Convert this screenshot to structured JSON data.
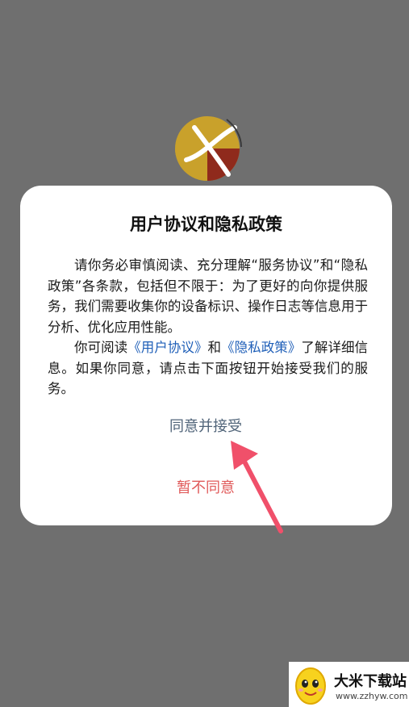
{
  "dialog": {
    "title": "用户协议和隐私政策",
    "paragraph1": "请你务必审慎阅读、充分理解“服务协议”和“隐私政策”各条款，包括但不限于：为了更好的向你提供服务，我们需要收集你的设备标识、操作日志等信息用于分析、优化应用性能。",
    "p2_prefix": "你可阅读",
    "user_agreement_link": "《用户协议》",
    "p2_and": "和",
    "privacy_policy_link": "《隐私政策》",
    "p2_suffix": "了解详细信息。如果你同意，请点击下面按钮开始接受我们的服务。",
    "agree_label": "同意并接受",
    "decline_label": "暂不同意"
  },
  "watermark": {
    "name": "大米下载站",
    "url": "www.zzhyw.com"
  },
  "colors": {
    "backdrop": "#6f6f6f",
    "dialog_bg": "#ffffff",
    "link": "#1f5fb8",
    "agree": "#4f6378",
    "decline": "#e05a5a",
    "arrow": "#f0506a"
  },
  "icons": {
    "app_logo": "app-logo-icon",
    "annotation_arrow": "arrow-icon",
    "watermark_mascot": "mascot-icon"
  }
}
